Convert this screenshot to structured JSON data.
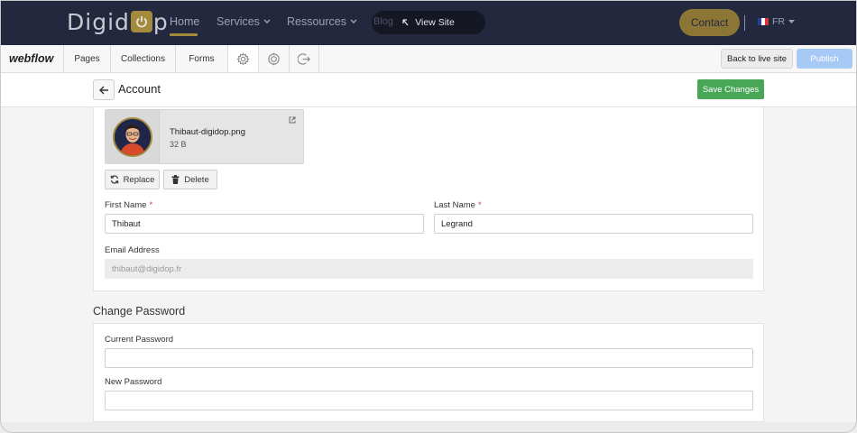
{
  "site_nav": {
    "logo_text_left": "Digid",
    "logo_text_right": "p",
    "links": {
      "home": "Home",
      "services": "Services",
      "ressources": "Ressources",
      "blog": "Blog"
    },
    "view_site": "View Site",
    "contact": "Contact",
    "language": "FR",
    "colors": {
      "background": "#23283f",
      "accent": "#a48a3c"
    }
  },
  "webflow_bar": {
    "logo": "webflow",
    "tabs": {
      "pages": "Pages",
      "collections": "Collections",
      "forms": "Forms"
    },
    "icons": [
      "gear-icon",
      "target-icon",
      "exit-icon"
    ],
    "back_to_live": "Back to live site",
    "publish": "Publish"
  },
  "account": {
    "title": "Account",
    "save": "Save Changes",
    "avatar": {
      "file_name": "Thibaut-digidop.png",
      "file_size": "32 B"
    },
    "replace": "Replace",
    "delete": "Delete",
    "first_name": {
      "label": "First Name",
      "required": "*",
      "value": "Thibaut"
    },
    "last_name": {
      "label": "Last Name",
      "required": "*",
      "value": "Legrand"
    },
    "email": {
      "label": "Email Address",
      "value": "thibaut@digidop.fr"
    }
  },
  "password": {
    "section_title": "Change Password",
    "current_label": "Current Password",
    "current_value": "",
    "new_label": "New Password",
    "new_value": ""
  },
  "colors": {
    "save_button": "#48a657",
    "publish_button": "#a7c9f5",
    "required": "#d9363e"
  }
}
